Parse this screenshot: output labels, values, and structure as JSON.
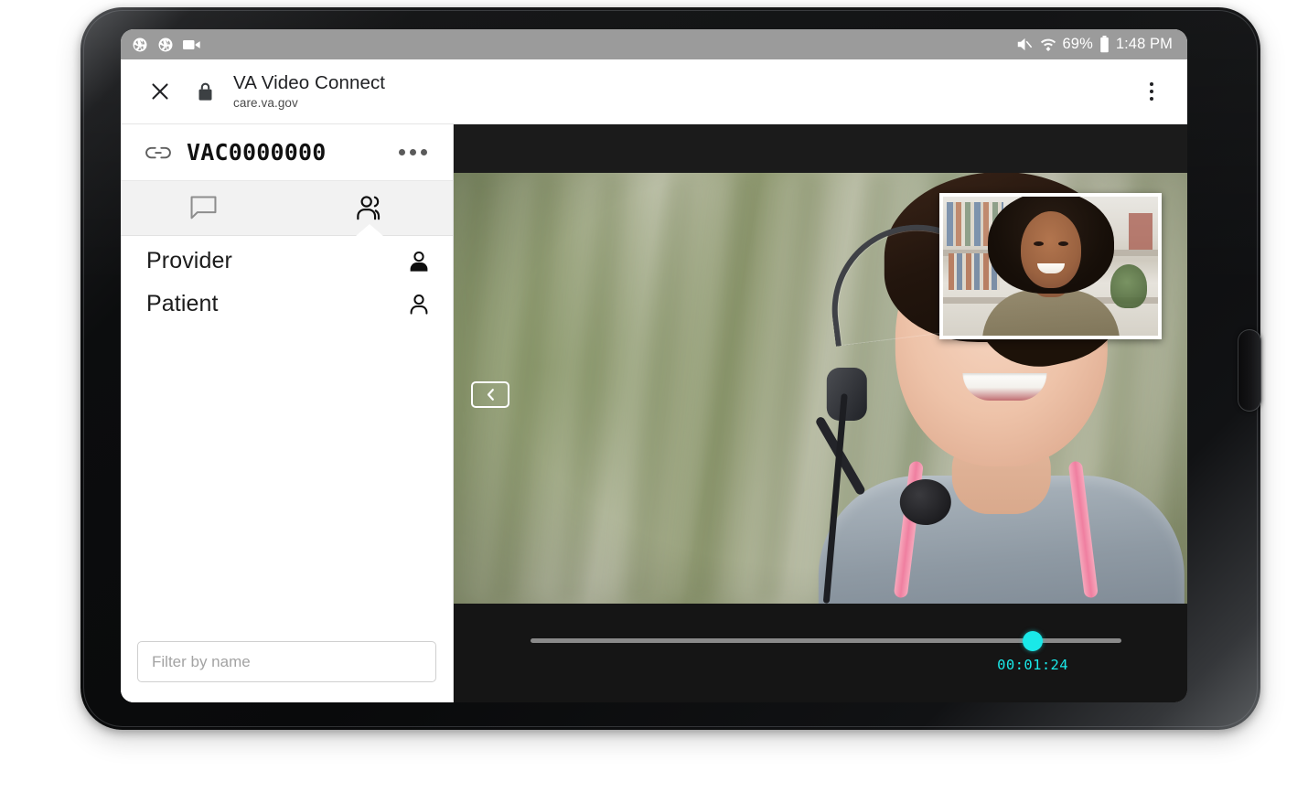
{
  "statusbar": {
    "icons_left": [
      "camera-shutter-icon",
      "camera-shutter-icon",
      "video-camera-icon"
    ],
    "mute_icon": "volume-mute-icon",
    "wifi_icon": "wifi-icon",
    "battery_percent": "69%",
    "battery_icon": "battery-icon",
    "time": "1:48 PM",
    "bg_color": "#9b9b9b"
  },
  "browser": {
    "close_icon": "close-icon",
    "lock_icon": "lock-icon",
    "title": "VA Video Connect",
    "url": "care.va.gov",
    "menu_icon": "more-vertical-icon"
  },
  "sidebar": {
    "link_icon": "link-icon",
    "meeting_id": "VAC0000000",
    "overflow_icon": "more-horizontal-icon",
    "tabs": [
      {
        "id": "chat",
        "icon": "chat-bubble-icon",
        "active": false
      },
      {
        "id": "participants",
        "icon": "people-icon",
        "active": true
      }
    ],
    "participants": [
      {
        "name": "Provider",
        "icon": "person-filled-icon"
      },
      {
        "name": "Patient",
        "icon": "person-outline-icon"
      }
    ],
    "filter_placeholder": "Filter by name",
    "filter_value": ""
  },
  "video": {
    "collapse_icon": "chevron-left-icon",
    "main_feed_label": "provider-video-feed",
    "pip_label": "self-video-feed",
    "slider_value_percent": 85,
    "elapsed_time": "00:01:24",
    "accent_color": "#1ae8e8"
  }
}
